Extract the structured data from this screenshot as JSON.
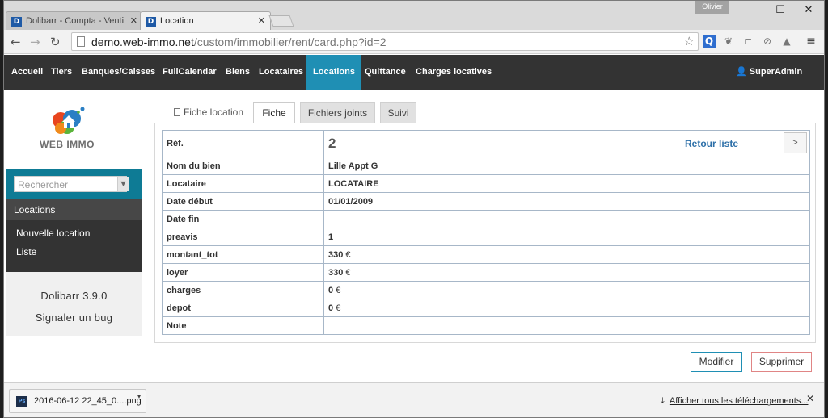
{
  "browser": {
    "tabs": [
      {
        "label": "Dolibarr - Compta - Venti",
        "icon": "dolibarr-icon"
      },
      {
        "label": "Location",
        "icon": "dolibarr-icon"
      }
    ],
    "profile_badge": "Olivier",
    "url_host": "demo.web-immo.net",
    "url_path": "/custom/immobilier/rent/card.php?id=2"
  },
  "topmenu": {
    "items": [
      "Accueil",
      "Tiers",
      "Banques/Caisses",
      "FullCalendar",
      "Biens",
      "Locataires",
      "Locations",
      "Quittance",
      "Charges locatives"
    ],
    "active": "Locations",
    "user": "SuperAdmin"
  },
  "sidebar": {
    "logo_text": "WEB IMMO",
    "search_placeholder": "Rechercher",
    "menu_title": "Locations",
    "links": [
      "Nouvelle location",
      "Liste"
    ],
    "version": "Dolibarr 3.9.0",
    "bug_link": "Signaler un bug"
  },
  "tabs": {
    "heading": "Fiche location",
    "items": [
      "Fiche",
      "Fichiers joints",
      "Suivi"
    ],
    "active": "Fiche"
  },
  "fiche": {
    "ref_label": "Réf.",
    "ref_value": "2",
    "back_link": "Retour liste",
    "next_button": ">",
    "rows": [
      {
        "label": "Nom du bien",
        "value": "Lille Appt G",
        "unit": ""
      },
      {
        "label": "Locataire",
        "value": "LOCATAIRE",
        "unit": ""
      },
      {
        "label": "Date début",
        "value": "01/01/2009",
        "unit": ""
      },
      {
        "label": "Date fin",
        "value": "",
        "unit": ""
      },
      {
        "label": "preavis",
        "value": "1",
        "unit": ""
      },
      {
        "label": "montant_tot",
        "value": "330",
        "unit": "€"
      },
      {
        "label": "loyer",
        "value": "330",
        "unit": "€"
      },
      {
        "label": "charges",
        "value": "0",
        "unit": "€"
      },
      {
        "label": "depot",
        "value": "0",
        "unit": "€"
      },
      {
        "label": "Note",
        "value": "",
        "unit": ""
      }
    ]
  },
  "actions": {
    "modify": "Modifier",
    "delete": "Supprimer"
  },
  "downloads": {
    "file": "2016-06-12 22_45_0....png",
    "show_all": "Afficher tous les téléchargements..."
  },
  "colors": {
    "topmenu_bg": "#333333",
    "active_menu": "#1f8fb4",
    "search_block": "#0e7b95"
  }
}
